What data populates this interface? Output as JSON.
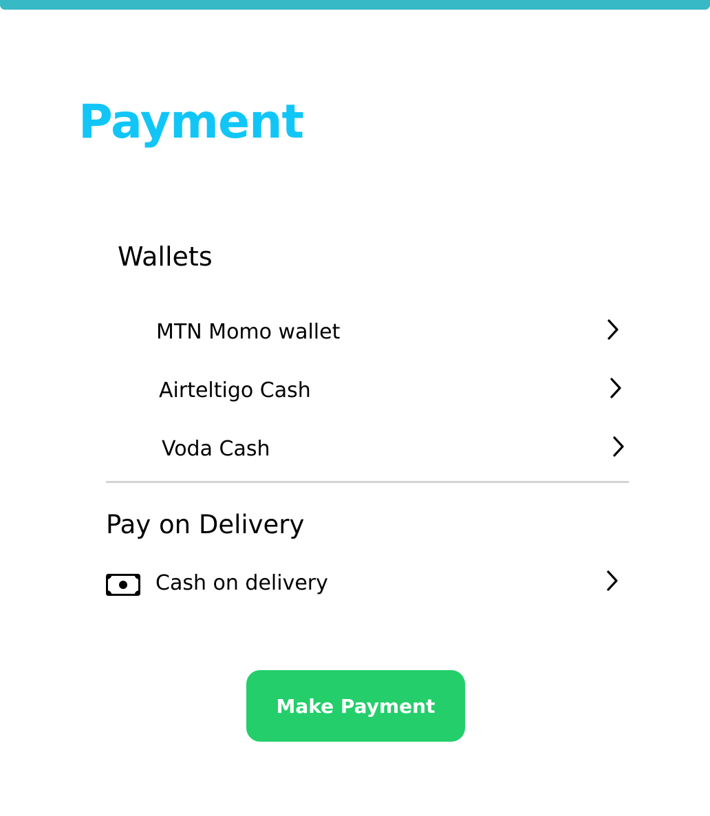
{
  "colors": {
    "top_bar": "#37B9C6",
    "title": "#11C6F7",
    "button_bg": "#24CE6B",
    "button_text": "#FFFFFF",
    "divider": "#D3D3D3",
    "text": "#000000"
  },
  "header": {
    "title": "Payment"
  },
  "wallets": {
    "heading": "Wallets",
    "items": [
      {
        "label": "MTN Momo wallet",
        "icon": "chevron-right-icon"
      },
      {
        "label": "Airteltigo Cash",
        "icon": "chevron-right-icon"
      },
      {
        "label": "Voda Cash",
        "icon": "chevron-right-icon"
      }
    ]
  },
  "delivery": {
    "heading": "Pay on Delivery",
    "items": [
      {
        "label": "Cash on delivery",
        "icon": "cash-icon",
        "chevron": "chevron-right-icon"
      }
    ]
  },
  "actions": {
    "make_payment_label": "Make Payment"
  }
}
